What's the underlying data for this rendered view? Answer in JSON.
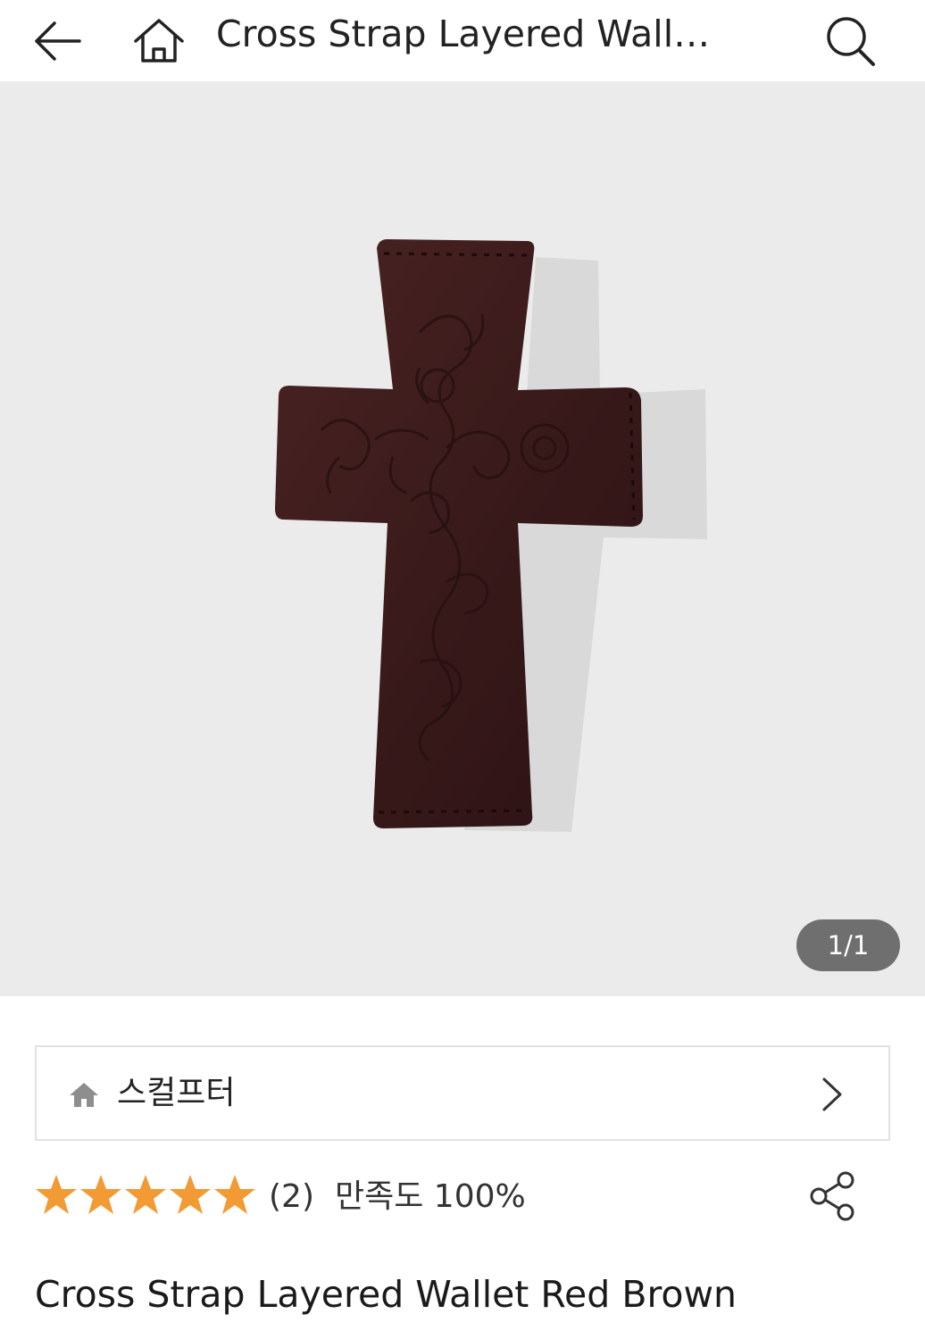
{
  "header": {
    "title": "Cross Strap Layered Wallet Red Brown",
    "back_icon": "arrow-left-icon",
    "home_icon": "home-icon",
    "search_icon": "search-icon"
  },
  "gallery": {
    "counter": "1/1",
    "background": "#ebebeb",
    "product_color": "#3d1c1c"
  },
  "brand": {
    "name": "스컬프터",
    "icon": "home-filled-icon",
    "chevron_icon": "chevron-right-icon"
  },
  "rating": {
    "stars": 5,
    "star_color": "#f29a33",
    "review_count": "(2)",
    "satisfaction": "만족도 100%",
    "share_icon": "share-icon"
  },
  "product": {
    "title": "Cross Strap Layered Wallet Red Brown"
  }
}
